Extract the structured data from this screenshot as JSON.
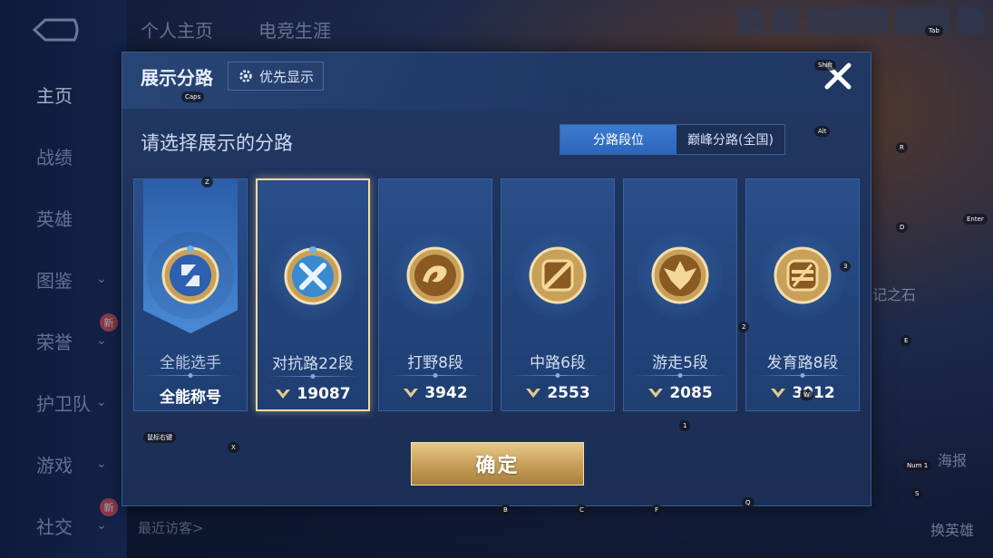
{
  "background": {
    "top_tabs": [
      "个人主页",
      "电竞生涯"
    ],
    "side_nav": [
      {
        "label": "主页",
        "chevron": false,
        "badge": ""
      },
      {
        "label": "战绩",
        "chevron": false,
        "badge": ""
      },
      {
        "label": "英雄",
        "chevron": false,
        "badge": ""
      },
      {
        "label": "图鉴",
        "chevron": true,
        "badge": ""
      },
      {
        "label": "荣誉",
        "chevron": true,
        "badge": "新"
      },
      {
        "label": "护卫队",
        "chevron": true,
        "badge": ""
      },
      {
        "label": "游戏",
        "chevron": true,
        "badge": ""
      },
      {
        "label": "社交",
        "chevron": true,
        "badge": "新"
      }
    ],
    "visitors_label": "最近访客>",
    "stone_text": "记之石",
    "right_labels": [
      "海报",
      "换英雄"
    ]
  },
  "modal": {
    "title": "展示分路",
    "priority_label": "优先显示",
    "subtitle": "请选择展示的分路",
    "toggle": [
      "分路段位",
      "巅峰分路(全国)"
    ],
    "confirm_label": "确定"
  },
  "cards": [
    {
      "role": "全能选手",
      "score": "全能称号",
      "icon": "all-round-emblem",
      "selected": false,
      "allround": true
    },
    {
      "role": "对抗路22段",
      "score": "19087",
      "icon": "clash-lane-emblem",
      "selected": true,
      "allround": false
    },
    {
      "role": "打野8段",
      "score": "3942",
      "icon": "jungle-dragon-emblem",
      "selected": false,
      "allround": false
    },
    {
      "role": "中路6段",
      "score": "2553",
      "icon": "mid-lane-emblem",
      "selected": false,
      "allround": false
    },
    {
      "role": "游走5段",
      "score": "2085",
      "icon": "roam-emblem",
      "selected": false,
      "allround": false
    },
    {
      "role": "发育路8段",
      "score": "3012",
      "icon": "farm-lane-emblem",
      "selected": false,
      "allround": false
    }
  ],
  "key_hints": [
    "Caps",
    "Shift",
    "Tab",
    "Alt",
    "Z",
    "R",
    "D",
    "Enter",
    "3",
    "2",
    "E",
    "X",
    "W",
    "1",
    "Num 1",
    "B",
    "C",
    "F",
    "Q",
    "S",
    "鼠标右键"
  ],
  "colors": {
    "accent_blue": "#2c66b8",
    "selected_border": "#f3dba0",
    "confirm_gold": "#c9a05a",
    "modal_bg": "#1d325b"
  }
}
